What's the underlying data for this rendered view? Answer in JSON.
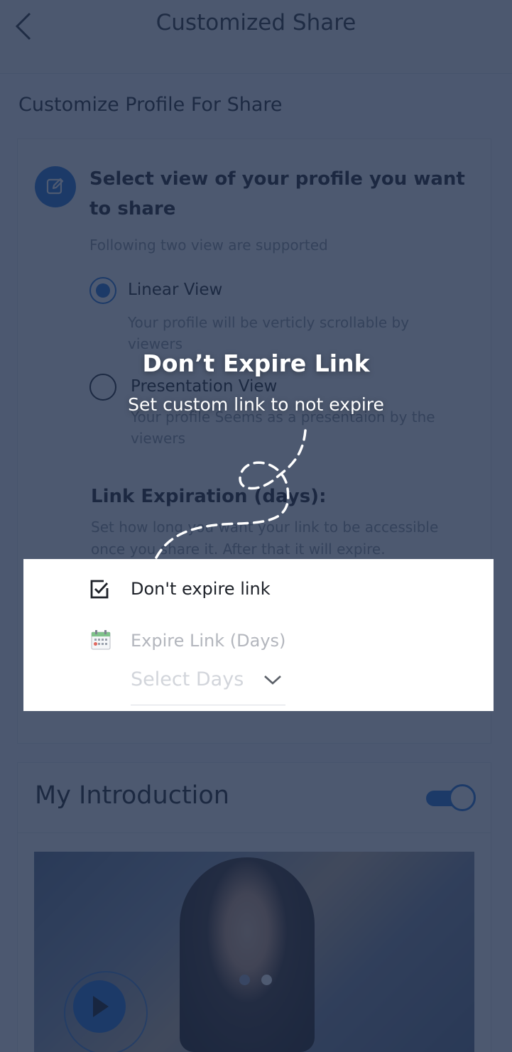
{
  "header": {
    "title": "Customized Share"
  },
  "section_title": "Customize Profile For Share",
  "view_card": {
    "heading": "Select view of your profile you want to share",
    "subtitle": "Following two view are supported",
    "options": [
      {
        "label": "Linear View",
        "description": "Your profile will be verticly scrollable by viewers",
        "selected": true
      },
      {
        "label": "Presentation View",
        "description": "Your profile Seems as a presentaion by the viewers",
        "selected": false
      }
    ],
    "expiration": {
      "title": "Link Expiration (days):",
      "description": "Set how long you want your link to be accessible once you share it. After that it will expire."
    }
  },
  "expire_panel": {
    "checkbox_label": "Don't expire link",
    "checked": true,
    "expire_label": "Expire Link (Days)",
    "select_placeholder": "Select Days"
  },
  "tooltip": {
    "title": "Don’t Expire Link",
    "subtitle": "Set custom link to not expire"
  },
  "intro": {
    "title": "My Introduction",
    "toggle_on": true,
    "slide_count": 2,
    "active_slide": 2
  },
  "colors": {
    "accent": "#1f6fd6",
    "overlay": "#1c2b49",
    "text": "#1d2128",
    "muted": "#8b9099"
  }
}
